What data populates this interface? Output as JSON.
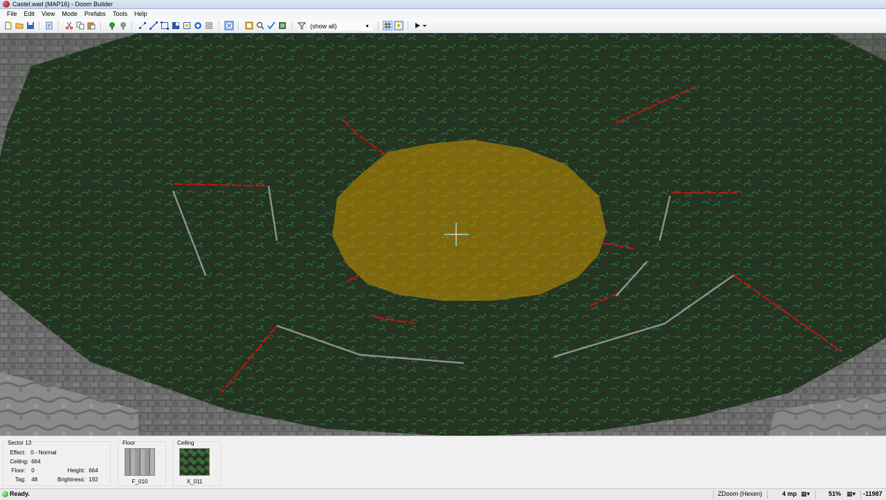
{
  "window": {
    "title": "Castel.wad (MAP16) - Doom Builder"
  },
  "menu": [
    "File",
    "Edit",
    "View",
    "Mode",
    "Prefabs",
    "Tools",
    "Help"
  ],
  "toolbar": {
    "icons": [
      "new-map-icon",
      "open-map-icon",
      "save-map-icon",
      "script-editor-icon",
      "cut-icon",
      "copy-icon",
      "paste-icon",
      "insert-prefab-icon",
      "insert-previous-prefab-icon",
      "vertices-mode-icon",
      "linedefs-mode-icon",
      "sectors-mode-icon",
      "things-mode-icon",
      "mode-brightness-icon",
      "3d-mode-icon",
      "visual-mode-icon",
      "thing-filter-icon",
      "texture-browser-icon",
      "zoom-icon",
      "check-map-icon",
      "make-sector-icon",
      "filter-icon",
      "grid-icon",
      "snap-icon",
      "play-icon",
      "play-options-icon"
    ],
    "filter_value": "(show all)"
  },
  "info": {
    "sector_title": "Sector 13",
    "effect_label": "Effect:",
    "effect_value": "0 - Normal",
    "ceiling_label": "Ceiling:",
    "ceiling_value": "664",
    "floor_label": "Floor:",
    "floor_value": "0",
    "height_label": "Height:",
    "height_value": "664",
    "tag_label": "Tag:",
    "tag_value": "48",
    "brightness_label": "Brightness:",
    "brightness_value": "192",
    "floor_group": "Floor",
    "floor_texture": "F_010",
    "ceiling_group": "Ceiling",
    "ceiling_texture": "X_011"
  },
  "status": {
    "text": "Ready.",
    "engine": "ZDoom (Hexen)",
    "grid": "4 mp",
    "zoom": "51%",
    "coords": "-11987"
  },
  "colors": {
    "highlight": "#c89400",
    "ground": "#233523",
    "wall_red": "#d01010",
    "crosshair": "#7fe0e0"
  }
}
